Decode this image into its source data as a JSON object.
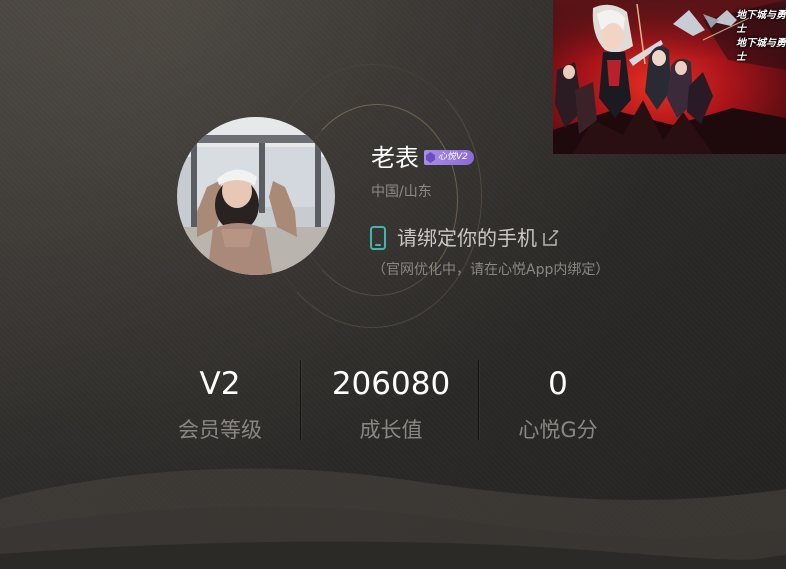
{
  "profile": {
    "username": "老表",
    "vip_badge": "心悦V2",
    "location": "中国/山东",
    "avatar_icon": "user-avatar-photo"
  },
  "phone_bind": {
    "icon": "mobile-phone-icon",
    "text": "请绑定你的手机",
    "edit_icon": "edit-icon",
    "note": "（官网优化中，请在心悦App内绑定）"
  },
  "stats": [
    {
      "value": "V2",
      "label": "会员等级"
    },
    {
      "value": "206080",
      "label": "成长值"
    },
    {
      "value": "0",
      "label": "心悦G分"
    }
  ],
  "game_banner": {
    "logo_text_1": "地下城与勇士",
    "logo_text_2": "地下城与勇士"
  },
  "colors": {
    "background": "#2e2c2a",
    "accent_teal": "#3fb7b0",
    "vip_purple": "#9b7ddf",
    "text_primary": "#ffffff",
    "text_secondary": "#8a8682"
  }
}
